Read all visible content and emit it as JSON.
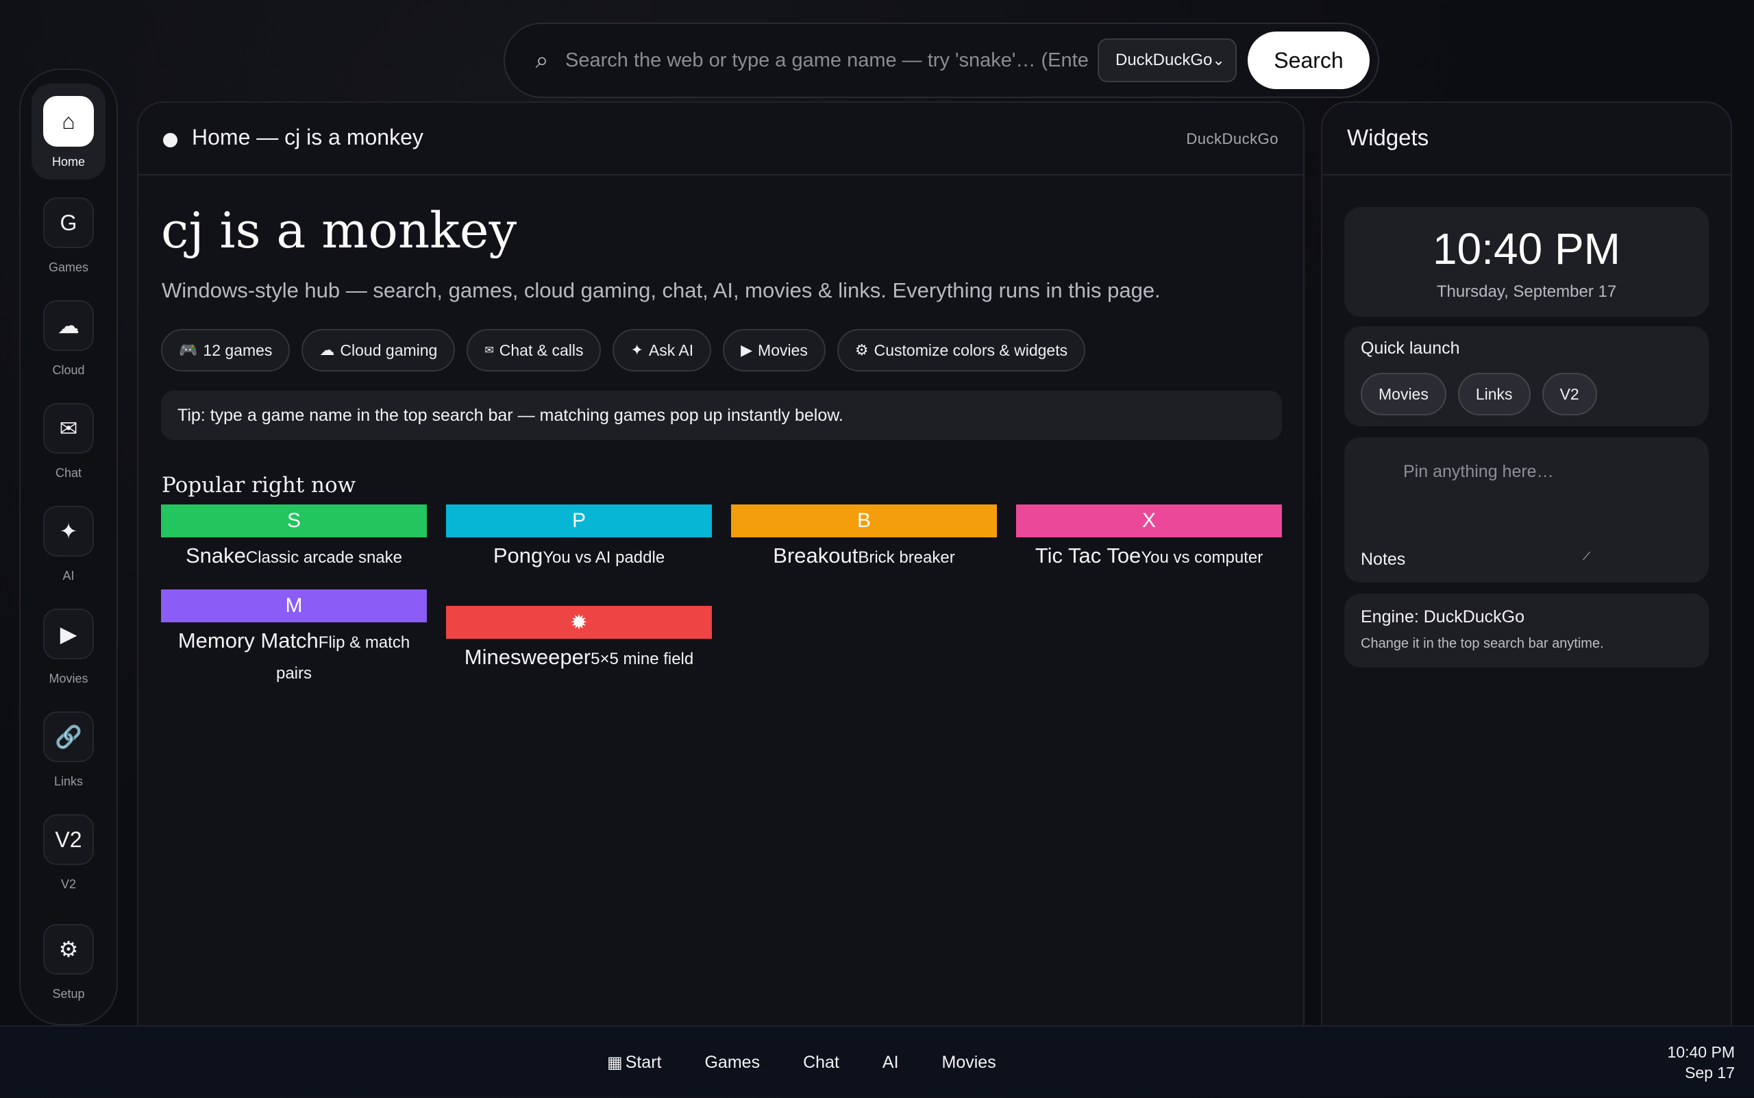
{
  "search": {
    "placeholder": "Search the web or type a game name — try 'snake'… (Enter to search)",
    "engine": "DuckDuckGo",
    "button_label": "Search"
  },
  "dock": {
    "items": [
      {
        "icon": "home-icon",
        "glyph": "⌂",
        "label": "Home",
        "active": true
      },
      {
        "icon": "games-icon",
        "glyph": "G",
        "label": "Games"
      },
      {
        "icon": "cloud-icon",
        "glyph": "☁",
        "label": "Cloud"
      },
      {
        "icon": "mail-icon",
        "glyph": "✉",
        "label": "Chat"
      },
      {
        "icon": "sparkle-icon",
        "glyph": "✦",
        "label": "AI"
      },
      {
        "icon": "play-icon",
        "glyph": "▶",
        "label": "Movies"
      },
      {
        "icon": "link-icon",
        "glyph": "🔗",
        "label": "Links"
      },
      {
        "icon": "v2-icon",
        "glyph": "V2",
        "label": "V2"
      },
      {
        "icon": "gear-icon",
        "glyph": "⚙",
        "label": "Setup"
      }
    ]
  },
  "main": {
    "header_title": "Home — cj is a monkey",
    "header_engine": "DuckDuckGo",
    "hero_title": "cj is a monkey",
    "hero_subtitle": "Windows-style hub — search, games, cloud gaming, chat, AI, movies & links. Everything runs in this page.",
    "chips": [
      {
        "icon": "gamepad-icon",
        "glyph": "🎮",
        "label": "12 games"
      },
      {
        "icon": "cloud-icon",
        "glyph": "☁",
        "label": "Cloud gaming"
      },
      {
        "icon": "mail-icon",
        "glyph": "✉",
        "label": "Chat & calls"
      },
      {
        "icon": "sparkle-icon",
        "glyph": "✦",
        "label": "Ask AI"
      },
      {
        "icon": "play-icon",
        "glyph": "▶",
        "label": "Movies"
      },
      {
        "icon": "gear-icon",
        "glyph": "⚙",
        "label": "Customize colors & widgets"
      }
    ],
    "tip": "Tip: type a game name in the top search bar — matching games pop up instantly below.",
    "popular_title": "Popular right now",
    "games": [
      {
        "letter": "S",
        "name": "Snake",
        "desc": "Classic arcade snake",
        "color": "#22c55e"
      },
      {
        "letter": "P",
        "name": "Pong",
        "desc": "You vs AI paddle",
        "color": "#06b6d4"
      },
      {
        "letter": "B",
        "name": "Breakout",
        "desc": "Brick breaker",
        "color": "#f59e0b"
      },
      {
        "letter": "X",
        "name": "Tic Tac Toe",
        "desc": "You vs computer",
        "color": "#ec4899"
      },
      {
        "letter": "M",
        "name": "Memory Match",
        "desc": "Flip & match pairs",
        "color": "#8b5cf6"
      },
      {
        "letter": "✹",
        "name": "Minesweeper",
        "desc": "5×5 mine field",
        "color": "#ef4444"
      }
    ]
  },
  "widgets": {
    "title": "Widgets",
    "clock_time": "10:40 PM",
    "clock_date": "Thursday, September 17",
    "quick_launch_title": "Quick launch",
    "quick_launch": [
      "Movies",
      "Links",
      "V2"
    ],
    "notes_placeholder": "Pin anything here…",
    "notes_label": "Notes",
    "engine_title": "Engine: DuckDuckGo",
    "engine_note": "Change it in the top search bar anytime."
  },
  "taskbar": {
    "items": [
      "Start",
      "Games",
      "Chat",
      "AI",
      "Movies"
    ],
    "time": "10:40 PM",
    "date": "Sep 17"
  },
  "colors": {
    "background": "#0c0d11",
    "panel": "#111217",
    "card": "#1e1f25",
    "accent": "#ffffff"
  }
}
